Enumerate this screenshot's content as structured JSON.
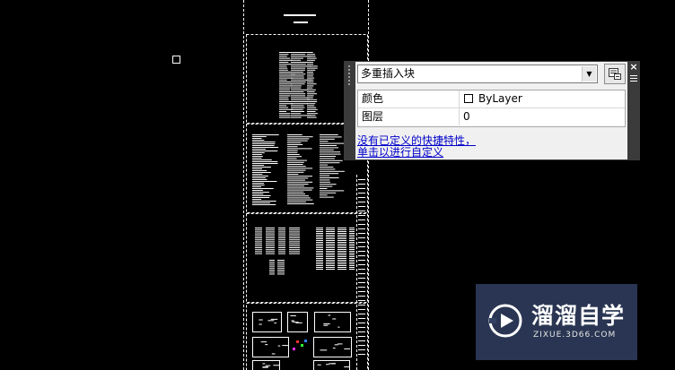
{
  "palette": {
    "object_type": "多重插入块",
    "properties": [
      {
        "name": "颜色",
        "value": "ByLayer",
        "has_swatch": true
      },
      {
        "name": "图层",
        "value": "0",
        "has_swatch": false
      }
    ],
    "link_line1": "没有已定义的快捷特性，",
    "link_line2": "单击以进行自定义",
    "close_glyph": "×"
  },
  "watermark": {
    "brand_cn": "溜溜自学",
    "url": "ZIXUE.3D66.COM"
  },
  "colors": {
    "canvas": "#000000",
    "drawing_lines": "#ffffff",
    "palette_frame": "#3b3b3b",
    "palette_body": "#f0f0f0",
    "link": "#0000cc",
    "watermark_bg": "#324164"
  },
  "icons": {
    "settings": "customize-quick-properties-icon",
    "close": "close-icon",
    "menu": "palette-menu-icon",
    "dropdown": "chevron-down-icon",
    "logo": "play-logo-icon"
  }
}
